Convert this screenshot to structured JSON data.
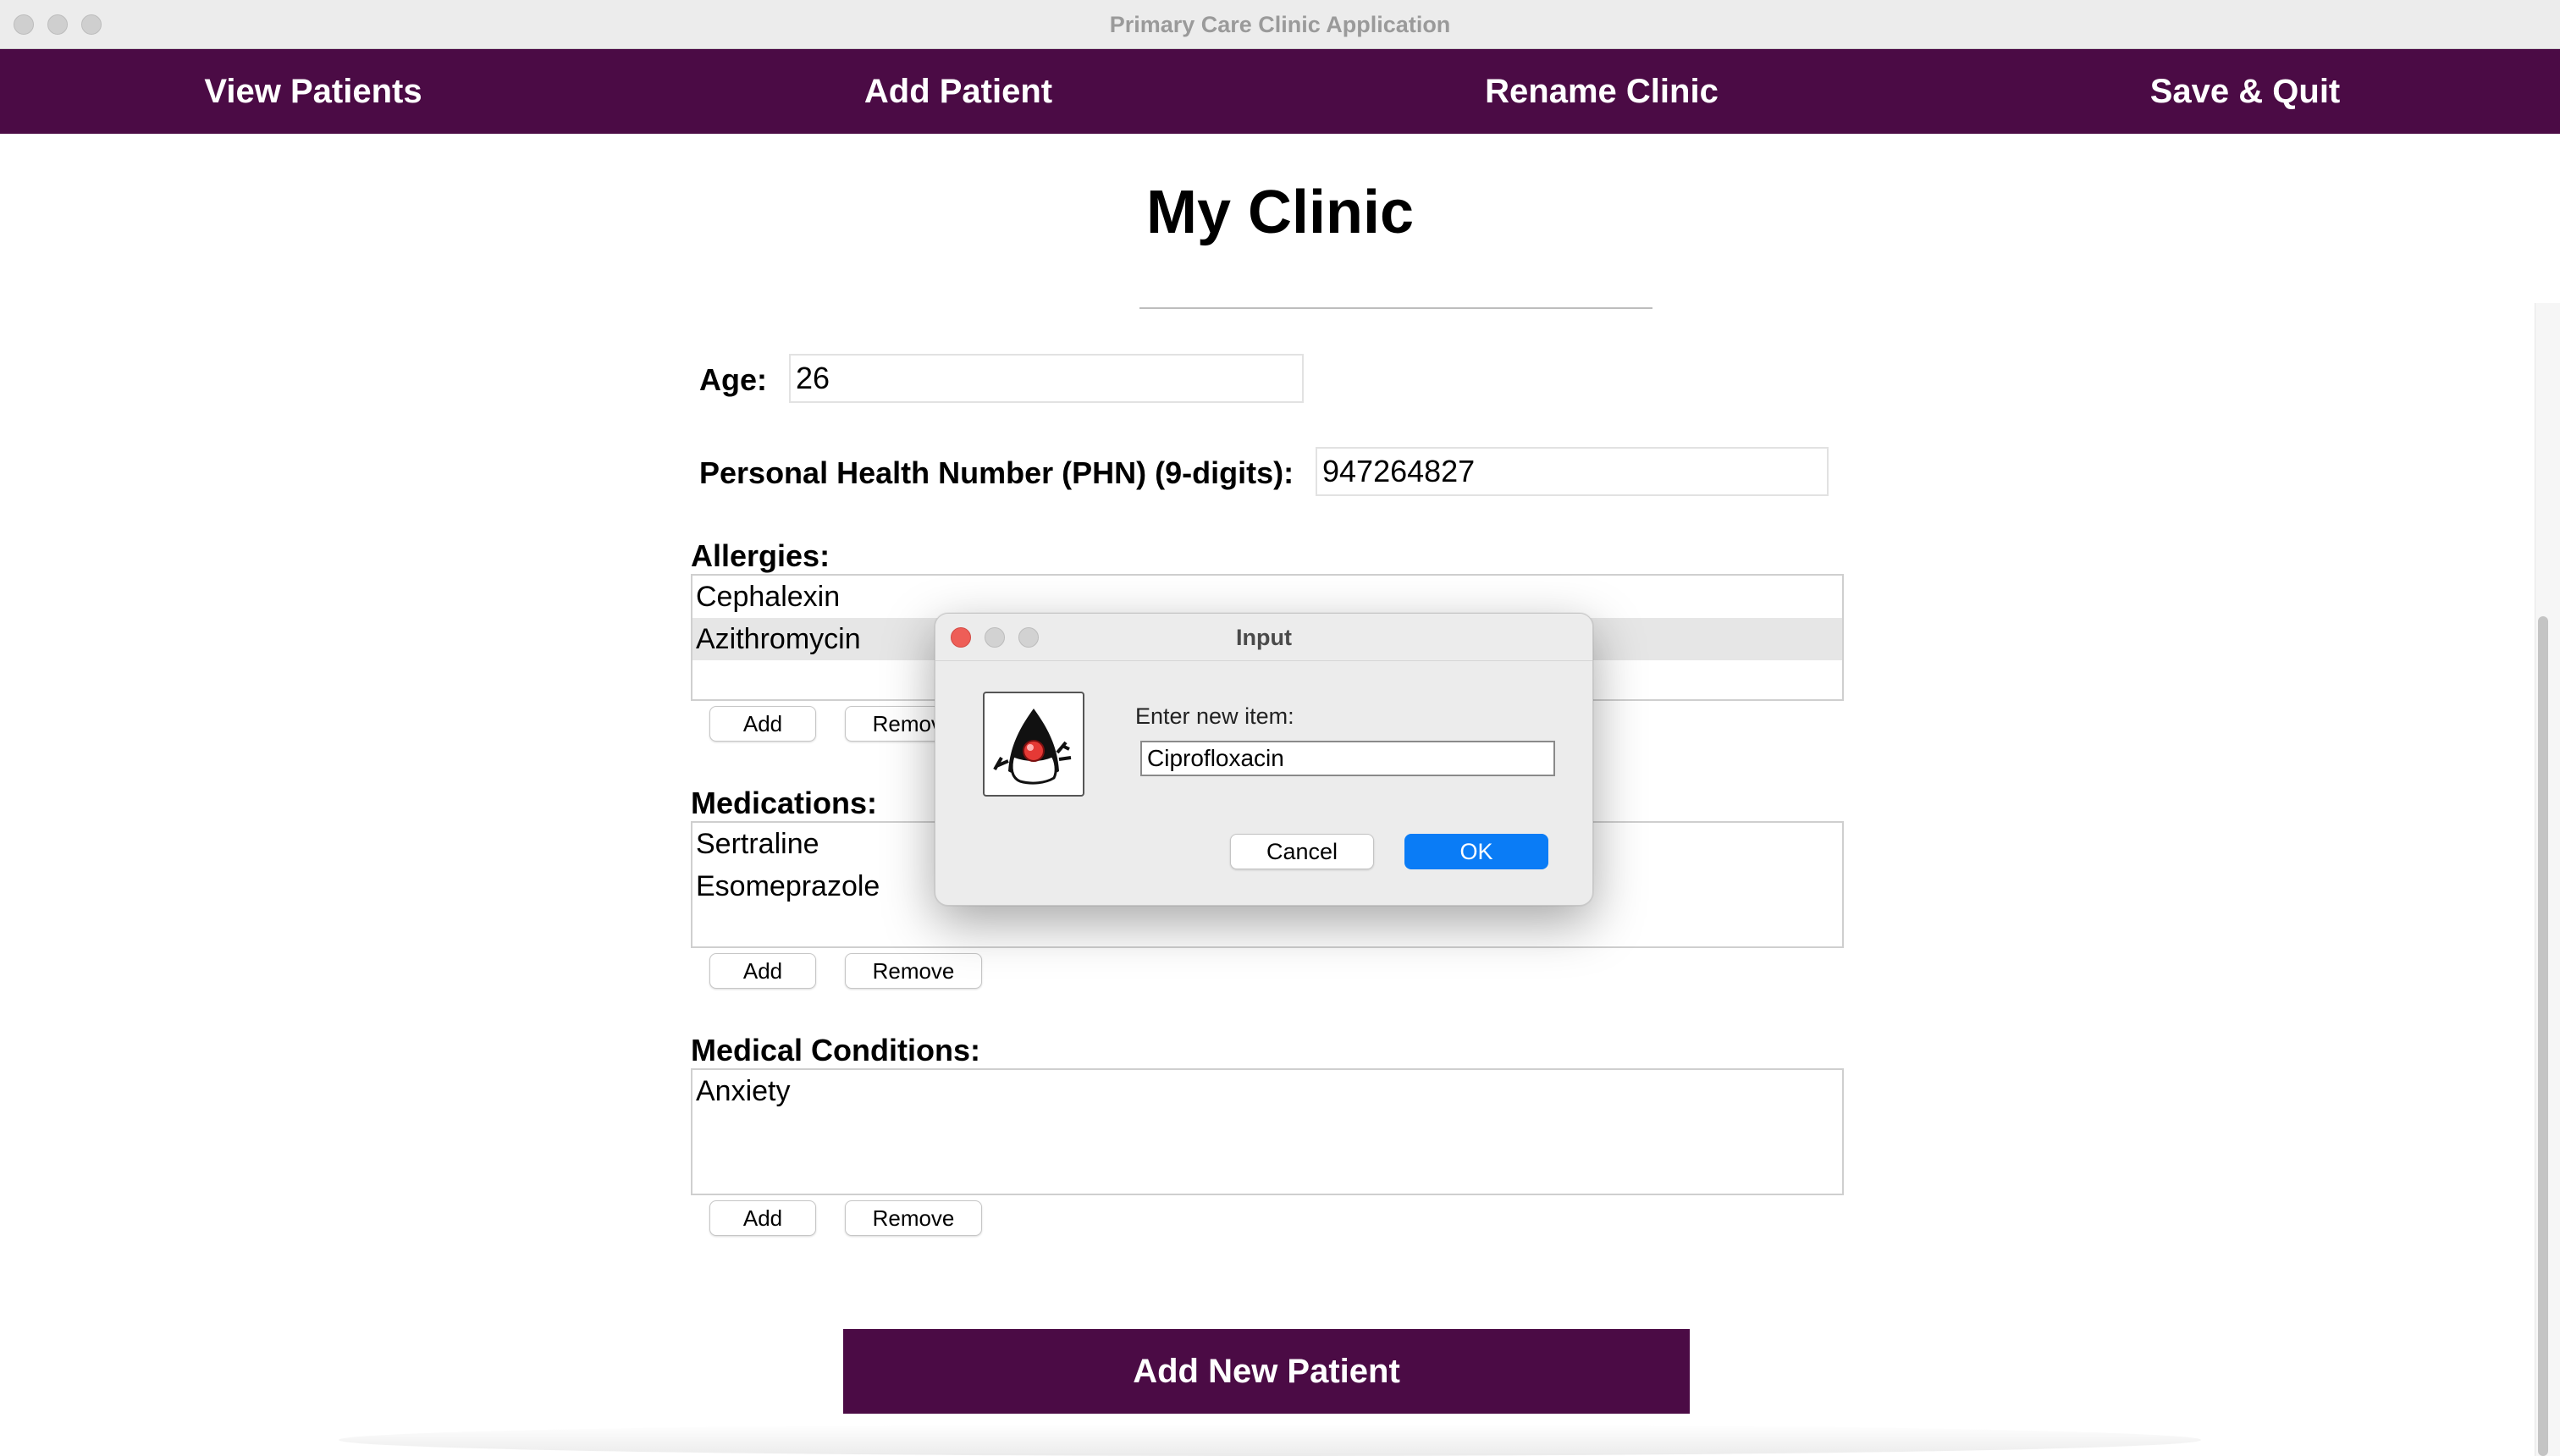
{
  "window": {
    "title": "Primary Care Clinic Application"
  },
  "menu": {
    "items": [
      {
        "label": "View Patients"
      },
      {
        "label": "Add Patient"
      },
      {
        "label": "Rename Clinic"
      },
      {
        "label": "Save & Quit"
      }
    ]
  },
  "clinic": {
    "name": "My Clinic"
  },
  "form": {
    "age_label": "Age:",
    "age_value": "26",
    "phn_label": "Personal Health Number (PHN) (9-digits):",
    "phn_value": "947264827",
    "allergies": {
      "label": "Allergies:",
      "items": [
        "Cephalexin",
        "Azithromycin"
      ],
      "selected": "Azithromycin"
    },
    "medications": {
      "label": "Medications:",
      "items": [
        "Sertraline",
        "Esomeprazole"
      ]
    },
    "conditions": {
      "label": "Medical Conditions:",
      "items": [
        "Anxiety"
      ]
    },
    "add_label": "Add",
    "remove_label": "Remove",
    "submit_label": "Add New Patient"
  },
  "dialog": {
    "title": "Input",
    "icon": "java-duke-icon",
    "prompt": "Enter new item:",
    "input_value": "Ciprofloxacin",
    "cancel_label": "Cancel",
    "ok_label": "OK"
  },
  "colors": {
    "brand": "#4b0b45",
    "ok_button": "#0a7cf6",
    "close_light": "#ee5e57"
  }
}
